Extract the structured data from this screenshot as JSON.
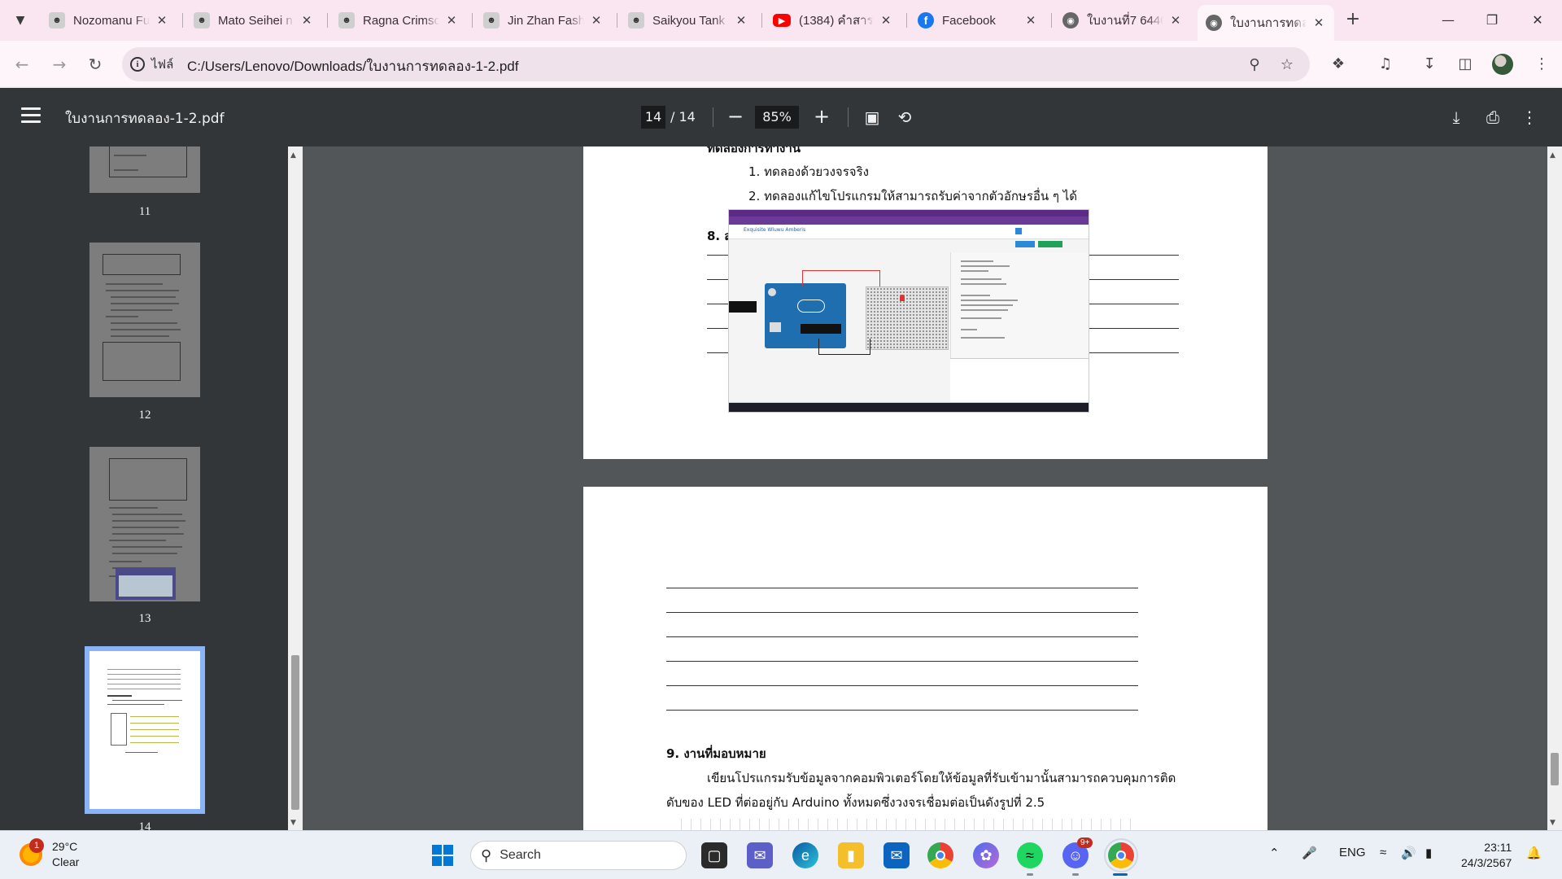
{
  "browser": {
    "tabs": [
      {
        "title": "Nozomanu Fu",
        "favicon": "manga-icon",
        "active": false
      },
      {
        "title": "Mato Seihei n",
        "favicon": "manga-icon",
        "active": false
      },
      {
        "title": "Ragna Crimso",
        "favicon": "manga-icon",
        "active": false
      },
      {
        "title": "Jin Zhan Fash",
        "favicon": "manga-icon",
        "active": false
      },
      {
        "title": "Saikyou Tank",
        "favicon": "manga-icon",
        "active": false
      },
      {
        "title": "(1384) คำสาร",
        "favicon": "youtube-icon",
        "active": false
      },
      {
        "title": "Facebook",
        "favicon": "facebook-icon",
        "active": false
      },
      {
        "title": "ใบงานที่7 6440",
        "favicon": "globe-icon",
        "active": false
      },
      {
        "title": "ใบงานการทดลอ",
        "favicon": "globe-icon",
        "active": true
      }
    ],
    "site_label": "ไฟล์",
    "url": "C:/Users/Lenovo/Downloads/ใบงานการทดลอง-1-2.pdf"
  },
  "pdf": {
    "title": "ใบงานการทดลอง-1-2.pdf",
    "page_current": "14",
    "page_total": "/ 14",
    "zoom": "85%",
    "thumbnails": [
      {
        "label": "11"
      },
      {
        "label": "12"
      },
      {
        "label": "13"
      },
      {
        "label": "14"
      }
    ]
  },
  "document": {
    "page13": {
      "heading_partial": "ทดลองการทำงาน",
      "list": [
        "1. ทดลองด้วยวงจรจริง",
        "2. ทดลองแก้ไขโปรแกรมให้สามารถรับค่าจากตัวอักษรอื่น ๆ ได้"
      ],
      "section8": "8. สรุปผลการปฏิบัติงาน",
      "screenshot_title": "Exquisite Wluwu Amberis"
    },
    "page14": {
      "section9": "9. งานที่มอบหมาย",
      "para_line1": "เขียนโปรแกรมรับข้อมูลจากคอมพิวเตอร์โดยให้ข้อมูลที่รับเข้ามานั้นสามารถควบคุมการติด",
      "para_line2": "ดับของ LED ที่ต่ออยู่กับ Arduino ทั้งหมดซึ่งวงจรเชื่อมต่อเป็นดังรูปที่ 2.5"
    }
  },
  "taskbar": {
    "weather_temp": "29°C",
    "weather_desc": "Clear",
    "weather_badge": "1",
    "search_label": "Search",
    "discord_badge": "9+",
    "lang": "ENG",
    "time": "23:11",
    "date": "24/3/2567"
  }
}
